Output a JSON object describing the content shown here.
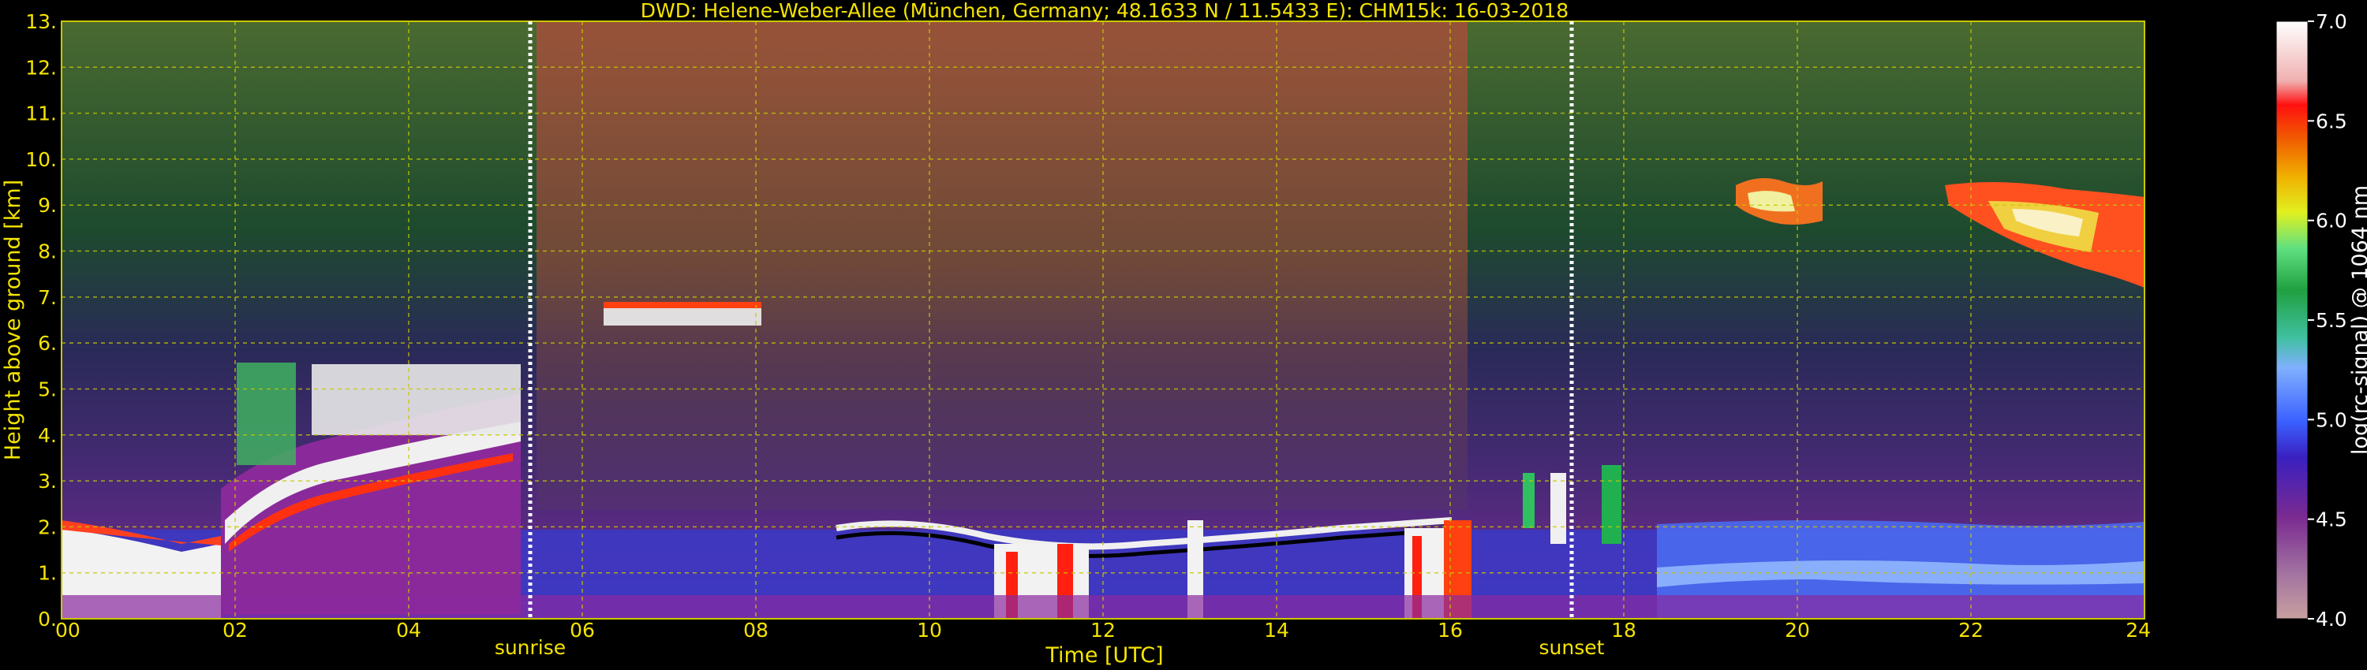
{
  "chart_data": {
    "type": "heatmap",
    "title": "DWD: Helene-Weber-Allee (München, Germany; 48.1633 N / 11.5433 E):    CHM15k: 16-03-2018",
    "xlabel": "Time [UTC]",
    "ylabel": "Height above ground [km]",
    "xlim": [
      0,
      24
    ],
    "ylim": [
      0,
      13
    ],
    "x_ticks": [
      "00",
      "02",
      "04",
      "06",
      "08",
      "10",
      "12",
      "14",
      "16",
      "18",
      "20",
      "22",
      "24"
    ],
    "y_ticks": [
      "0.",
      "1.",
      "2.",
      "3.",
      "4.",
      "5.",
      "6.",
      "7.",
      "8.",
      "9.",
      "10.",
      "11.",
      "12.",
      "13."
    ],
    "grid": true,
    "colorbar": {
      "label": "log(rc-signal) @ 1064 nm",
      "range": [
        4.0,
        7.0
      ],
      "ticks": [
        "4.0",
        "4.5",
        "5.0",
        "5.5",
        "6.0",
        "6.5",
        "7.0"
      ]
    },
    "markers": [
      {
        "label": "sunrise",
        "time": 5.4
      },
      {
        "label": "sunset",
        "time": 17.4
      }
    ]
  },
  "colors": {
    "axis_text": "#f5e400",
    "grid": "#c8c800",
    "marker_line": "#ffffff"
  }
}
